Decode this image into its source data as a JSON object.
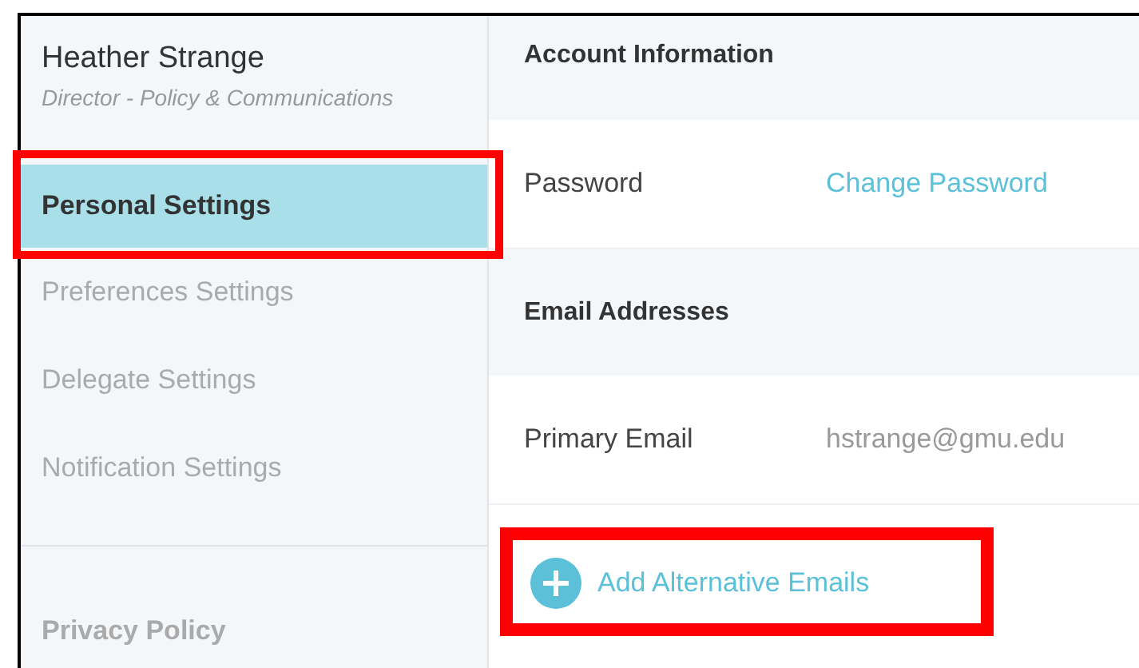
{
  "profile": {
    "name": "Heather Strange",
    "title": "Director - Policy & Communications"
  },
  "sidebar": {
    "items": [
      {
        "label": "Personal Settings",
        "selected": true,
        "highlighted": true
      },
      {
        "label": "Preferences Settings",
        "selected": false,
        "highlighted": false
      },
      {
        "label": "Delegate Settings",
        "selected": false,
        "highlighted": false
      },
      {
        "label": "Notification Settings",
        "selected": false,
        "highlighted": false
      }
    ],
    "footer_link": "Privacy Policy"
  },
  "sections": [
    {
      "heading": "Account Information",
      "rows": [
        {
          "label": "Password",
          "value": "Change Password",
          "kind": "link"
        }
      ]
    },
    {
      "heading": "Email Addresses",
      "rows": [
        {
          "label": "Primary Email",
          "value": "hstrange@gmu.edu",
          "kind": "text"
        }
      ]
    }
  ],
  "add_button": {
    "label": "Add Alternative Emails",
    "highlighted": true
  }
}
